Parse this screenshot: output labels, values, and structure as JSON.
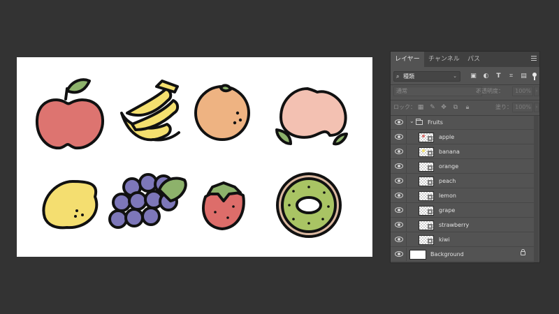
{
  "panel": {
    "tabs": [
      "レイヤー",
      "チャンネル",
      "パス"
    ],
    "active_tab": 0,
    "kind_filter": "種類",
    "filter_icons": [
      "image-filter-icon",
      "adjustment-filter-icon",
      "type-filter-icon",
      "shape-filter-icon",
      "smart-object-filter-icon"
    ],
    "blend_mode": "通常",
    "opacity_label": "不透明度：",
    "opacity_value": "100%",
    "lock_label": "ロック：",
    "lock_icons": [
      "lock-transparent-icon",
      "lock-image-icon",
      "lock-position-icon",
      "lock-artboard-icon",
      "lock-all-icon"
    ],
    "fill_label": "塗り：",
    "fill_value": "100%"
  },
  "layers": {
    "group": {
      "name": "Fruits",
      "expanded": true
    },
    "items": [
      {
        "name": "apple",
        "color": "#d9706e"
      },
      {
        "name": "banana",
        "color": "#f2e06d"
      },
      {
        "name": "orange",
        "color": "#ecb07f"
      },
      {
        "name": "peach",
        "color": "#f0bfb0"
      },
      {
        "name": "lemon",
        "color": "#f3de6e"
      },
      {
        "name": "grape",
        "color": "#7a73b6"
      },
      {
        "name": "strawberry",
        "color": "#d9706e"
      },
      {
        "name": "kiwi",
        "color": "#a8c466"
      }
    ],
    "background": {
      "name": "Background",
      "locked": true
    }
  },
  "canvas": {
    "fruits": [
      "apple",
      "banana",
      "orange",
      "peach",
      "lemon",
      "grape",
      "strawberry",
      "kiwi"
    ],
    "colors": {
      "apple": "#dd7470",
      "banana": "#f5e06f",
      "orange": "#eeb382",
      "peach": "#f3c1b2",
      "lemon": "#f4de70",
      "grape": "#7d77b9",
      "strawberry": "#dd6d6a",
      "kiwi": "#a9c464",
      "leaf": "#8db26b",
      "outline": "#111111"
    }
  }
}
